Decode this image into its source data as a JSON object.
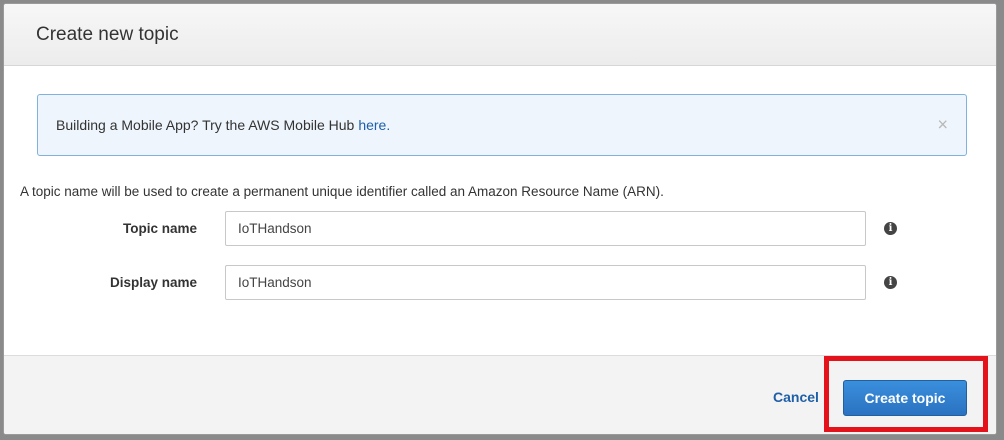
{
  "dialog": {
    "title": "Create new topic"
  },
  "banner": {
    "text": "Building a Mobile App? Try the AWS Mobile Hub",
    "link_text": "here.",
    "close_symbol": "×"
  },
  "description": "A topic name will be used to create a permanent unique identifier called an Amazon Resource Name (ARN).",
  "form": {
    "topic_name": {
      "label": "Topic name",
      "value": "IoTHandson"
    },
    "display_name": {
      "label": "Display name",
      "value": "IoTHandson"
    },
    "info_icon": "i"
  },
  "footer": {
    "cancel_label": "Cancel",
    "create_label": "Create topic"
  },
  "colors": {
    "highlight": "#e3121b",
    "primary_button": "#2a72c2",
    "link": "#1f5fa8"
  }
}
